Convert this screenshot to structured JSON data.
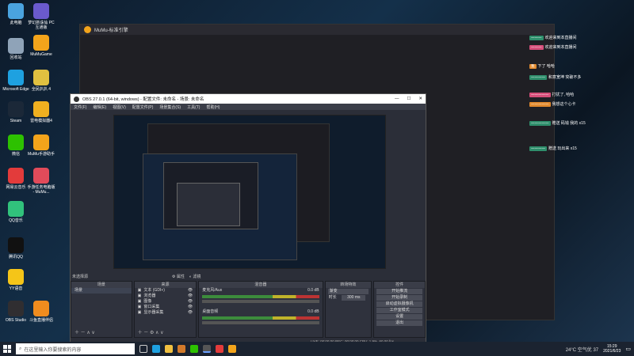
{
  "desktop_icons": [
    {
      "label": "此电脑",
      "color": "#4aa3df"
    },
    {
      "label": "回收站",
      "color": "#8fa3b8"
    },
    {
      "label": "Microsoft Edge",
      "color": "#1ea1e0"
    },
    {
      "label": "Steam",
      "color": "#1b2838"
    },
    {
      "label": "微信",
      "color": "#2dc100"
    },
    {
      "label": "网易云音乐",
      "color": "#e33b3b"
    },
    {
      "label": "QQ音乐",
      "color": "#31c27c"
    },
    {
      "label": "腾讯QQ",
      "color": "#111"
    },
    {
      "label": "YY语音",
      "color": "#f5c518"
    },
    {
      "label": "OBS Studio",
      "color": "#302e31"
    },
    {
      "label": "梦幻新诛仙 PC互通版",
      "color": "#6a5acd"
    },
    {
      "label": "MuMuGame",
      "color": "#f3a41b"
    },
    {
      "label": "全民扒扒 4",
      "color": "#e0c040"
    },
    {
      "label": "雷电模拟器4",
      "color": "#f0b020"
    },
    {
      "label": "MuMu手游助手",
      "color": "#f3a41b"
    },
    {
      "label": "手游任务电脑版 - MuMu...",
      "color": "#e14b5a"
    },
    {
      "label": "斗鱼直播伴侣",
      "color": "#f08c1e"
    }
  ],
  "mumu": {
    "title": "MuMu-标准引擎"
  },
  "obs": {
    "title": "OBS 27.0.1 (64-bit, windows) - 配置文件: 未命名 - 场景: 未命名",
    "menu": [
      "文件(F)",
      "编辑(E)",
      "视图(V)",
      "配置文件(P)",
      "场景集合(S)",
      "工具(T)",
      "帮助(H)"
    ],
    "status_left": "未选择源",
    "props": "属性",
    "filters": "滤镜",
    "docks": {
      "scenes": {
        "header": "场景",
        "items": [
          "场景"
        ]
      },
      "sources": {
        "header": "来源",
        "items": [
          "文本 (GDI+)",
          "浏览器",
          "图像",
          "窗口采集",
          "显示器采集"
        ]
      },
      "mixer": {
        "header": "混音器",
        "tracks": [
          {
            "name": "麦克风/Aux",
            "db": "0.0 dB"
          },
          {
            "name": "桌面音频",
            "db": "0.0 dB"
          }
        ]
      },
      "transitions": {
        "header": "转场特效",
        "type": "渐变",
        "duration_label": "时长",
        "duration": "300 ms"
      },
      "controls": {
        "header": "控件",
        "buttons": [
          "开始推流",
          "开始录制",
          "启动虚拟摄像机",
          "工作室模式",
          "设置",
          "退出"
        ]
      }
    },
    "statusbar": "LIVE: 00:00:00   REC: 00:00:00   CPU: 1.9%, 60.00 fps"
  },
  "chat": [
    {
      "badge": "一一一",
      "text": "欢迎来到本直播间",
      "color": "green"
    },
    {
      "badge": "一一一",
      "text": "欢迎来到本直播间",
      "color": "pink"
    },
    {
      "name": "我",
      "text": "下了 哈哈",
      "color": "orange"
    },
    {
      "name": "一一一一",
      "text": "和意宽坤 突破不多",
      "color": "green"
    },
    {
      "name": "一一一一一",
      "text": "打扰了, 哈哈",
      "color": "pink"
    },
    {
      "name": "一一一一一",
      "text": "我想这个心卡",
      "color": "orange"
    },
    {
      "name": "一一一一一",
      "text": "赠送 码钱 我的 x15",
      "color": "green"
    },
    {
      "name": "一一一一",
      "text": "赠送 玩出来 x15",
      "color": "green"
    }
  ],
  "taskbar": {
    "search_placeholder": "在这里输入你要搜索的内容",
    "weather": "24°C 空气优 37",
    "time": "15:29",
    "date": "2021/6/23"
  }
}
